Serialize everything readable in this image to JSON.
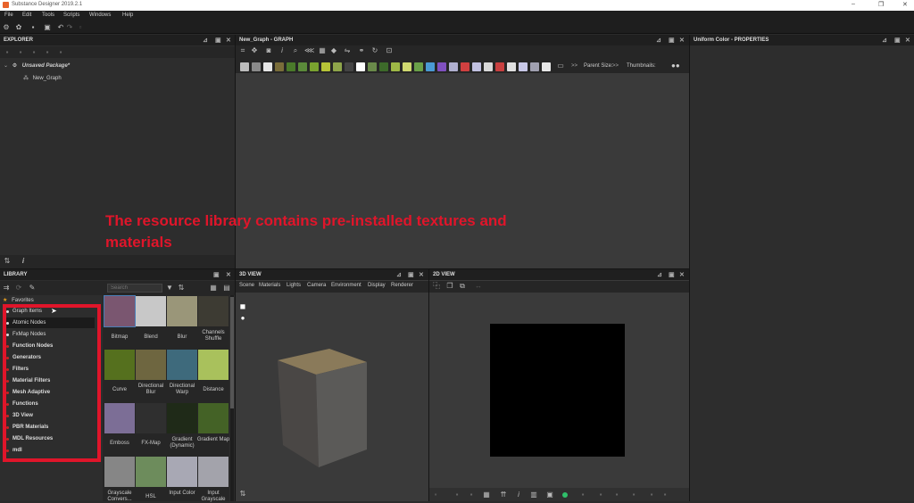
{
  "window": {
    "title": "Substance Designer 2019.2.1"
  },
  "menu": [
    "File",
    "Edit",
    "Tools",
    "Scripts",
    "Windows",
    "Help"
  ],
  "explorer": {
    "title": "EXPLORER",
    "package": "Unsaved Package*",
    "graph": "New_Graph"
  },
  "graph": {
    "title": "New_Graph - GRAPH",
    "parent_size": "Parent Size:",
    "thumbnails": "Thumbnails:",
    "more": ">>"
  },
  "properties": {
    "title": "Uniform Color - PROPERTIES"
  },
  "annotation": "The resource library contains pre-installed textures and materials",
  "library": {
    "title": "LIBRARY",
    "search_placeholder": "Search",
    "favorites": "Favorites",
    "items": [
      "Graph Items",
      "Atomic Nodes",
      "FxMap Nodes",
      "Function Nodes",
      "Generators",
      "Filters",
      "Material Filters",
      "Mesh Adaptive",
      "Functions",
      "3D View",
      "PBR Materials",
      "MDL Resources",
      "mdl"
    ],
    "thumbs": [
      {
        "label": "Bitmap",
        "color": "#7a5670"
      },
      {
        "label": "Blend",
        "color": "#c8c8c8"
      },
      {
        "label": "Blur",
        "color": "#9a9679"
      },
      {
        "label": "Channels Shuffle",
        "color": "#3d3b33"
      },
      {
        "label": "Curve",
        "color": "#55701e"
      },
      {
        "label": "Directional Blur",
        "color": "#6e6640"
      },
      {
        "label": "Directional Warp",
        "color": "#3e6a7c"
      },
      {
        "label": "Distance",
        "color": "#a9c15c"
      },
      {
        "label": "Emboss",
        "color": "#7c6e96"
      },
      {
        "label": "FX-Map",
        "color": "#2f2f2f"
      },
      {
        "label": "Gradient (Dynamic)",
        "color": "#1f2a18"
      },
      {
        "label": "Gradient Map",
        "color": "#446226"
      },
      {
        "label": "Grayscale Convers...",
        "color": "#868686"
      },
      {
        "label": "HSL",
        "color": "#6d8c5c"
      },
      {
        "label": "Input Color",
        "color": "#a8a8b4"
      },
      {
        "label": "Input Grayscale",
        "color": "#a3a3ab"
      }
    ]
  },
  "view3d": {
    "title": "3D VIEW",
    "menu": [
      "Scene",
      "Materials",
      "Lights",
      "Camera",
      "Environment",
      "Display",
      "Renderer"
    ]
  },
  "view2d": {
    "title": "2D VIEW"
  },
  "icons": {
    "close": "close-icon",
    "pin": "pin-icon",
    "maximize": "maximize-icon"
  },
  "colors": {
    "accent_red": "#e0152a",
    "panel": "#2d2d2d",
    "header": "#1f1f1f"
  }
}
